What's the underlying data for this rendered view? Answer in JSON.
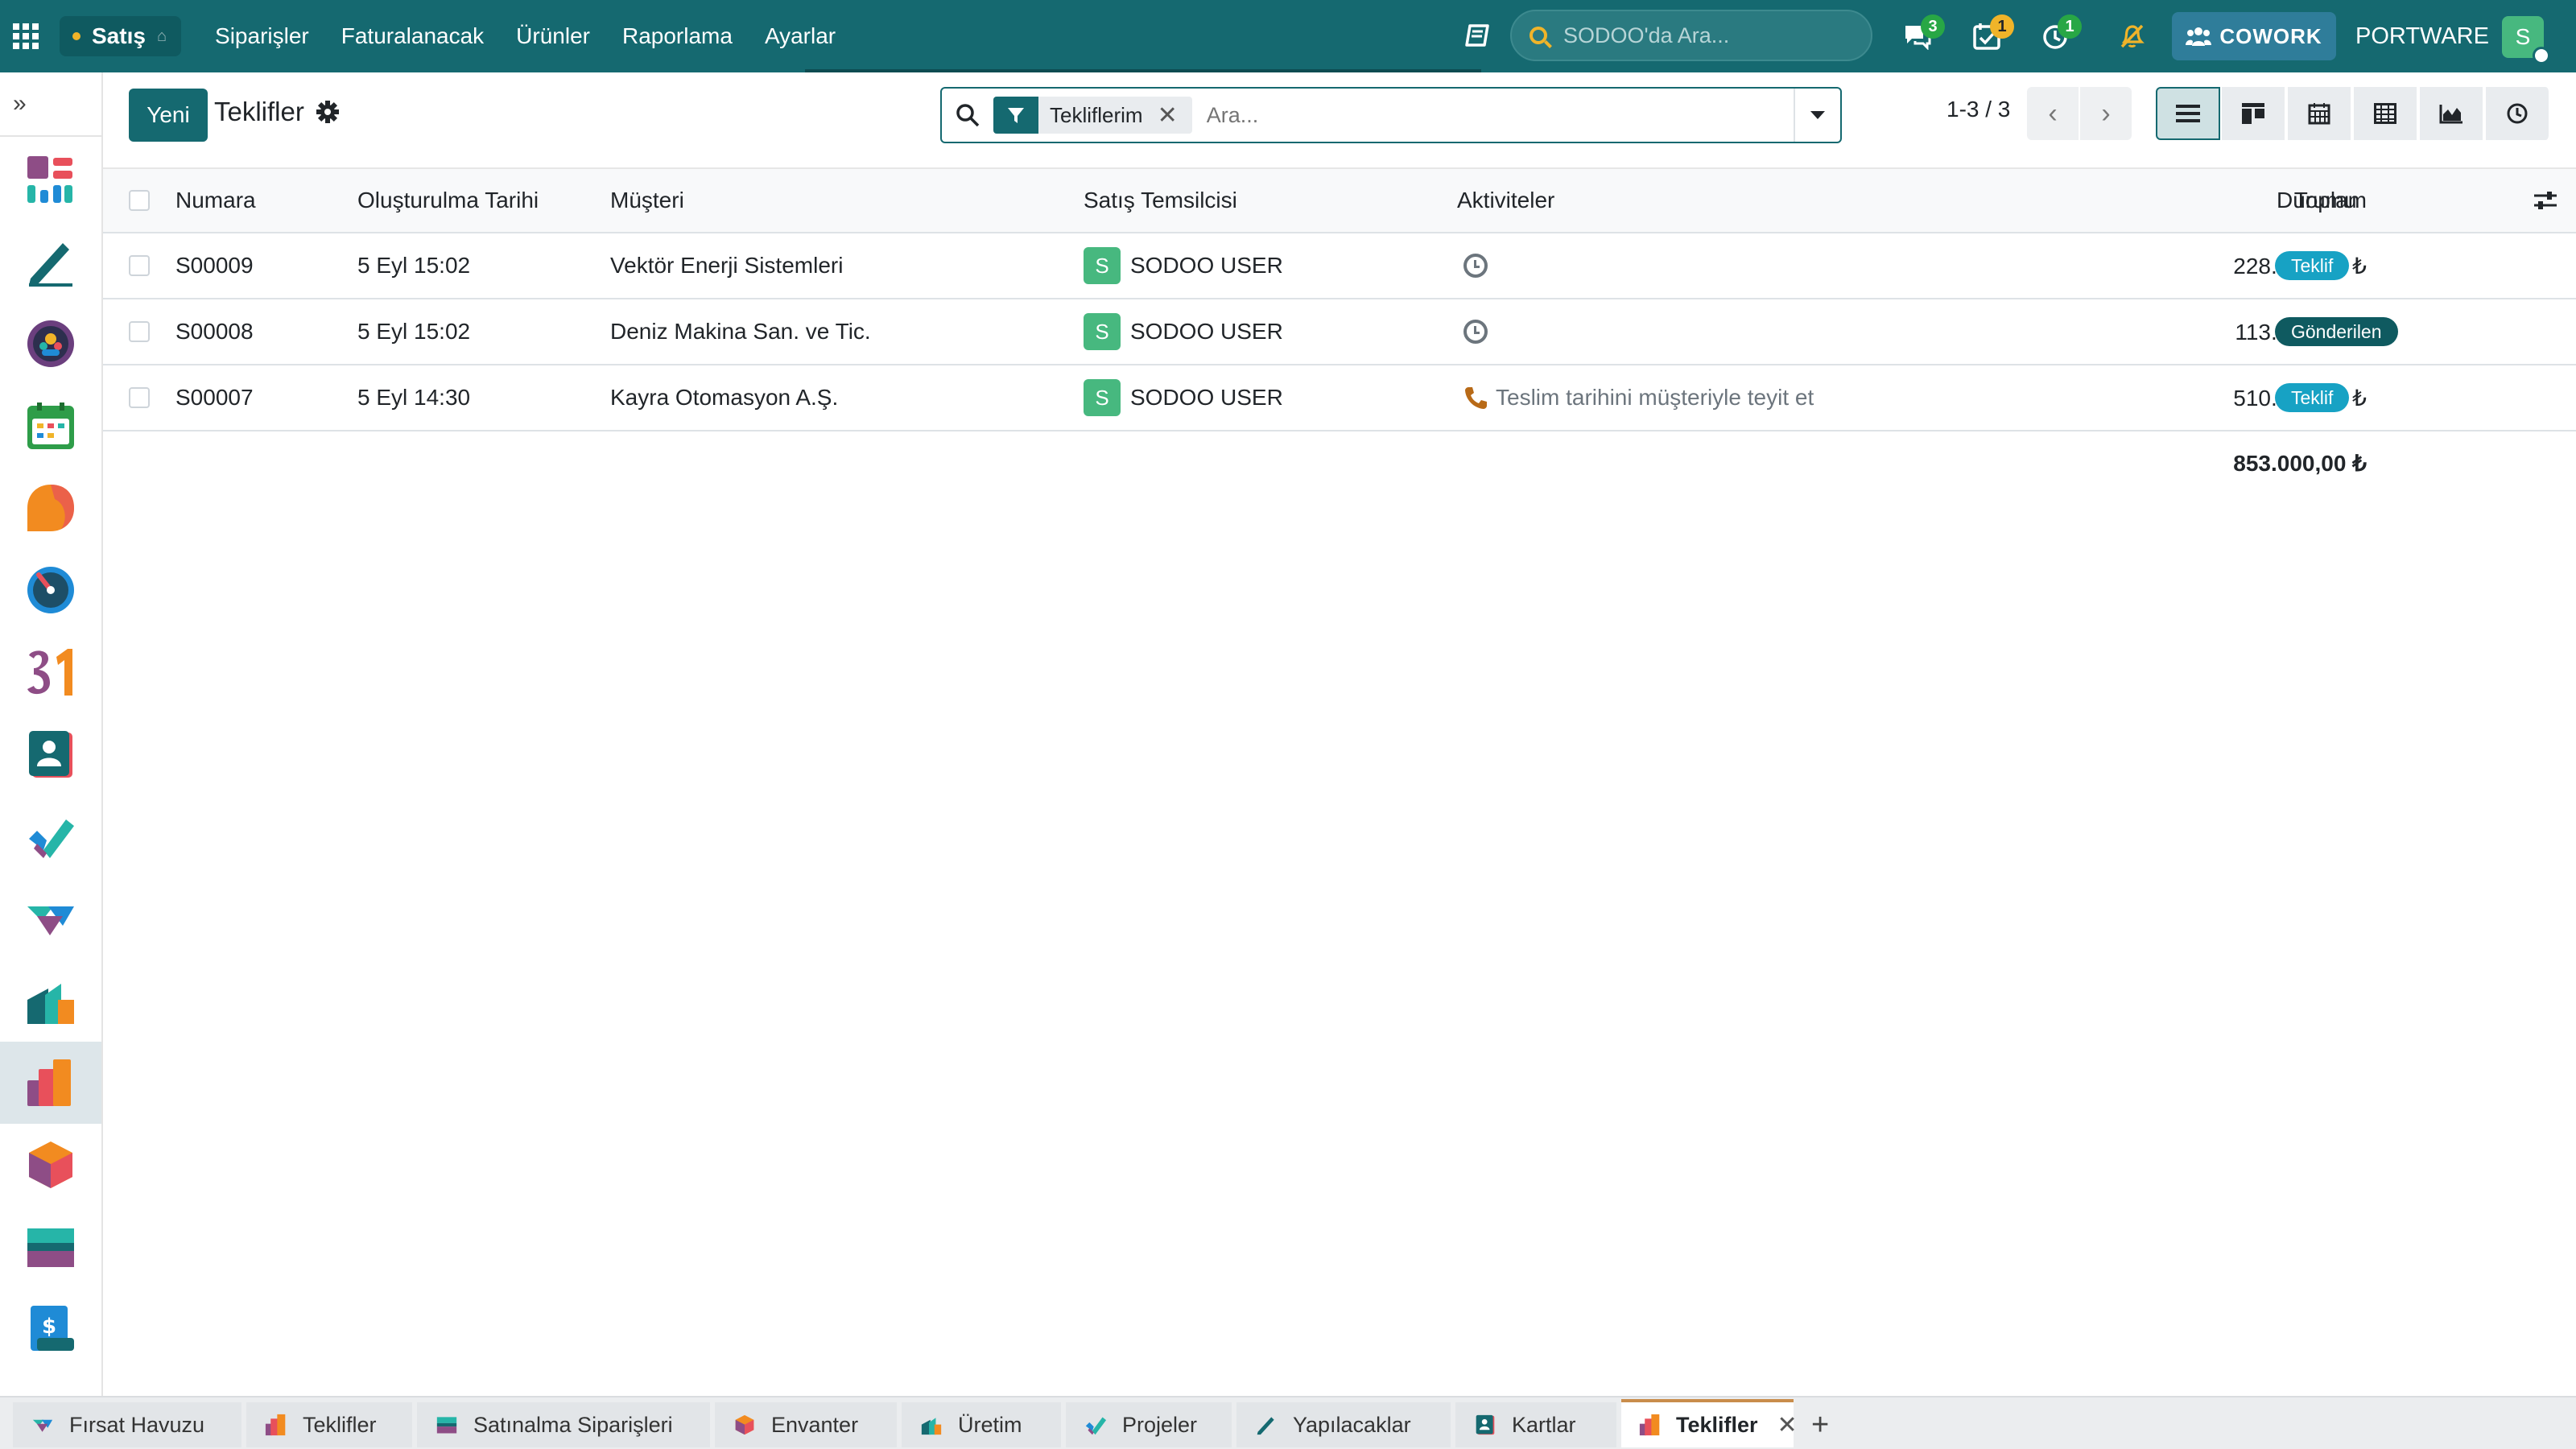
{
  "topbar": {
    "app_name": "Satış",
    "menu": [
      "Siparişler",
      "Faturalanacak",
      "Ürünler",
      "Raporlama",
      "Ayarlar"
    ],
    "search_placeholder": "SODOO'da Ara...",
    "badges": {
      "messages": "3",
      "activities": "1",
      "timesheets": "1"
    },
    "cowork_label": "COWORK",
    "company": "PORTWARE",
    "user_initial": "S"
  },
  "control": {
    "new_button": "Yeni",
    "title": "Teklifler",
    "facet_label": "Tekliflerim",
    "search_placeholder": "Ara...",
    "pager": "1-3 / 3"
  },
  "table": {
    "headers": {
      "number": "Numara",
      "created": "Oluşturulma Tarihi",
      "customer": "Müşteri",
      "salesperson": "Satış Temsilcisi",
      "activities": "Aktiviteler",
      "total": "Toplam",
      "status": "Durumu"
    },
    "rows": [
      {
        "number": "S00009",
        "created": "5 Eyl 15:02",
        "customer": "Vektör Enerji Sistemleri",
        "user_initial": "S",
        "salesperson": "SODOO USER",
        "activity": "",
        "total": "228.400,00 ₺",
        "status": "Teklif"
      },
      {
        "number": "S00008",
        "created": "5 Eyl 15:02",
        "customer": "Deniz Makina San. ve Tic.",
        "user_initial": "S",
        "salesperson": "SODOO USER",
        "activity": "",
        "total": "113.800,00 ₺",
        "status": "Gönderilen"
      },
      {
        "number": "S00007",
        "created": "5 Eyl 14:30",
        "customer": "Kayra Otomasyon A.Ş.",
        "user_initial": "S",
        "salesperson": "SODOO USER",
        "activity": "Teslim tarihini müşteriyle teyit et",
        "total": "510.800,00 ₺",
        "status": "Teklif"
      }
    ],
    "grand_total": "853.000,00 ₺"
  },
  "tabs": [
    {
      "label": "Fırsat Havuzu",
      "icon": "crm-icon"
    },
    {
      "label": "Teklifler",
      "icon": "sales-icon"
    },
    {
      "label": "Satınalma Siparişleri",
      "icon": "purchase-icon"
    },
    {
      "label": "Envanter",
      "icon": "inventory-icon"
    },
    {
      "label": "Üretim",
      "icon": "manufacturing-icon"
    },
    {
      "label": "Projeler",
      "icon": "project-icon"
    },
    {
      "label": "Yapılacaklar",
      "icon": "todo-icon"
    },
    {
      "label": "Kartlar",
      "icon": "contacts-icon"
    },
    {
      "label": "Teklifler",
      "icon": "sales-icon"
    }
  ],
  "colors": {
    "brand": "#156970",
    "status_teklif": "#17a2c4",
    "status_gonderilen": "#0f5a60",
    "badge_green": "#28a745",
    "badge_yellow": "#f0b429"
  }
}
